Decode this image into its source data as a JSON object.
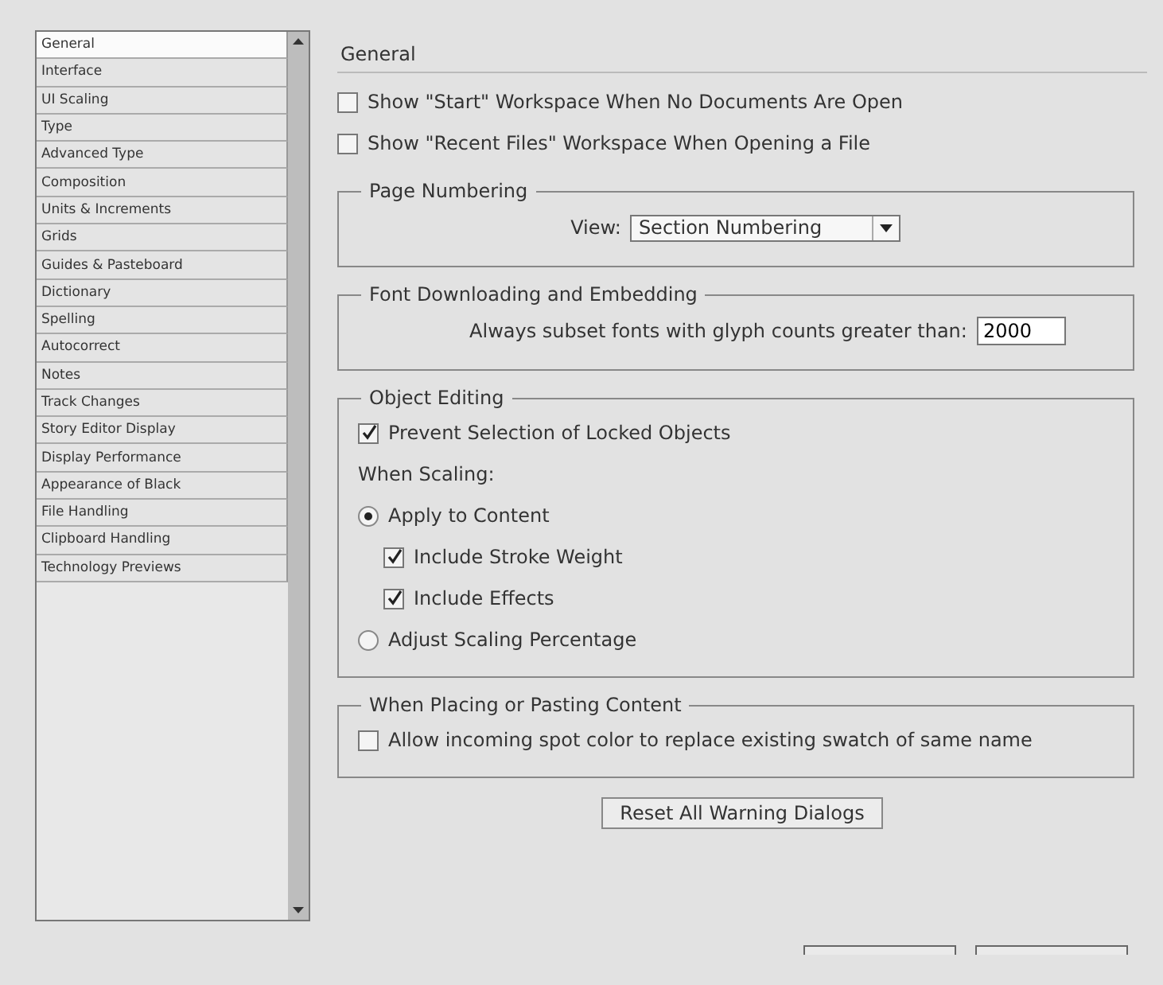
{
  "sidebar": {
    "items": [
      {
        "label": "General",
        "selected": true
      },
      {
        "label": "Interface",
        "selected": false
      },
      {
        "label": "UI Scaling",
        "selected": false
      },
      {
        "label": "Type",
        "selected": false
      },
      {
        "label": "Advanced Type",
        "selected": false
      },
      {
        "label": "Composition",
        "selected": false
      },
      {
        "label": "Units & Increments",
        "selected": false
      },
      {
        "label": "Grids",
        "selected": false
      },
      {
        "label": "Guides & Pasteboard",
        "selected": false
      },
      {
        "label": "Dictionary",
        "selected": false
      },
      {
        "label": "Spelling",
        "selected": false
      },
      {
        "label": "Autocorrect",
        "selected": false
      },
      {
        "label": "Notes",
        "selected": false
      },
      {
        "label": "Track Changes",
        "selected": false
      },
      {
        "label": "Story Editor Display",
        "selected": false
      },
      {
        "label": "Display Performance",
        "selected": false
      },
      {
        "label": "Appearance of Black",
        "selected": false
      },
      {
        "label": "File Handling",
        "selected": false
      },
      {
        "label": "Clipboard Handling",
        "selected": false
      },
      {
        "label": "Technology Previews",
        "selected": false
      }
    ]
  },
  "page": {
    "title": "General"
  },
  "options": [
    {
      "kind": "checkbox",
      "label": "Show \"Start\" Workspace When No Documents Are Open",
      "checked": false
    },
    {
      "kind": "checkbox",
      "label": "Show \"Recent Files\" Workspace When Opening a File",
      "checked": false
    }
  ],
  "groups": [
    {
      "title": "Page Numbering",
      "items": [
        {
          "kind": "dropdown",
          "label": "View:",
          "value": "Section Numbering"
        }
      ]
    },
    {
      "title": "Font Downloading and Embedding",
      "items": [
        {
          "kind": "number_field",
          "label": "Always subset fonts with glyph counts greater than:",
          "value": "2000"
        }
      ]
    },
    {
      "title": "Object Editing",
      "items": [
        {
          "kind": "checkbox",
          "label": "Prevent Selection of Locked Objects",
          "checked": true
        },
        {
          "kind": "label",
          "label": "When Scaling:"
        },
        {
          "kind": "radio",
          "label": "Apply to Content",
          "selected": true,
          "children": [
            {
              "kind": "checkbox",
              "label": "Include Stroke Weight",
              "checked": true
            },
            {
              "kind": "checkbox",
              "label": "Include Effects",
              "checked": true
            }
          ]
        },
        {
          "kind": "radio",
          "label": "Adjust Scaling Percentage",
          "selected": false
        }
      ]
    },
    {
      "title": "When Placing or Pasting Content",
      "items": [
        {
          "kind": "checkbox",
          "label": "Allow incoming spot color to replace existing swatch of same name",
          "checked": false
        }
      ]
    }
  ],
  "reset_button": "Reset All Warning Dialogs"
}
